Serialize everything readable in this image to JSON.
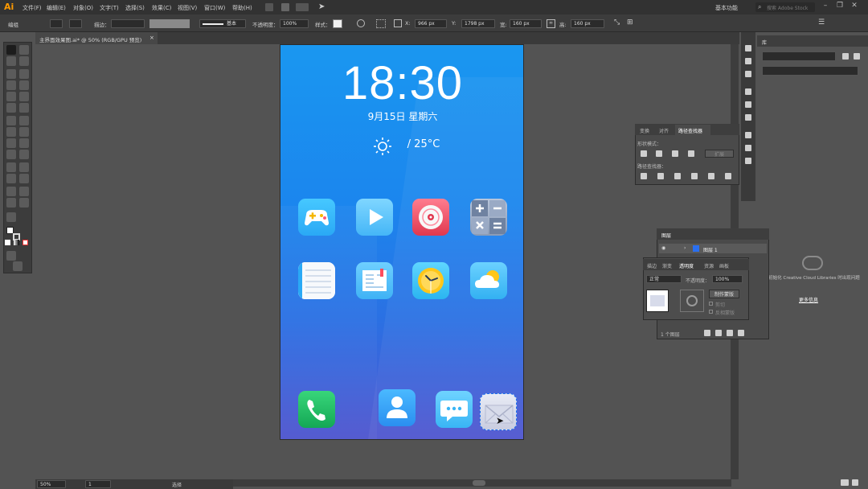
{
  "app": {
    "logo": "Ai",
    "menu": [
      "文件(F)",
      "编辑(E)",
      "对象(O)",
      "文字(T)",
      "选择(S)",
      "效果(C)",
      "视图(V)",
      "窗口(W)",
      "帮助(H)"
    ],
    "workspace": "基本功能",
    "search_placeholder": "搜索 Adobe Stock"
  },
  "control": {
    "mode": "编组",
    "stroke_label": "描边：",
    "stroke_style": "基本",
    "opacity_label": "不透明度：",
    "opacity": "100%",
    "style_label": "样式：",
    "x_label": "X:",
    "x": "966 px",
    "y_label": "Y:",
    "y": "1798 px",
    "w_label": "宽:",
    "w": "160 px",
    "h_label": "高:",
    "h": "160 px"
  },
  "document": {
    "tab": "主界面效果图.ai* @ 50% (RGB/GPU 预览)",
    "close": "×"
  },
  "status": {
    "zoom": "50%",
    "page": "1",
    "tool": "选择"
  },
  "phone": {
    "time": "18:30",
    "date": "9月15日  星期六",
    "weather": "/  25°C",
    "icons": [
      "game-app",
      "video-app",
      "music-app",
      "calculator-app",
      "notes-app",
      "reader-app",
      "clock-app",
      "weather-app",
      "phone-app",
      "contacts-app",
      "messages-app",
      "mail-app"
    ]
  },
  "pathfinder": {
    "tabs": [
      "变换",
      "对齐",
      "路径查找器"
    ],
    "shape_modes": "形状模式：",
    "expand": "扩展",
    "pathfinders": "路径查找器："
  },
  "layers": {
    "title": "图层",
    "layer1": "图层 1",
    "count": "1 个图层"
  },
  "transparency": {
    "tabs": [
      "描边",
      "渐变",
      "透明度",
      "资源",
      "画板"
    ],
    "blend": "正常",
    "opacity_label": "不透明度：",
    "opacity": "100%",
    "make_mask": "制作蒙版",
    "clip": "剪切",
    "invert": "反相蒙版"
  },
  "libraries": {
    "title": "库",
    "message": "初始化 Creative Cloud Libraries 时出现问题",
    "more": "更多信息"
  },
  "colors": {
    "accent": "#1a97f0",
    "menubar": "#323232",
    "panel": "#535353"
  }
}
